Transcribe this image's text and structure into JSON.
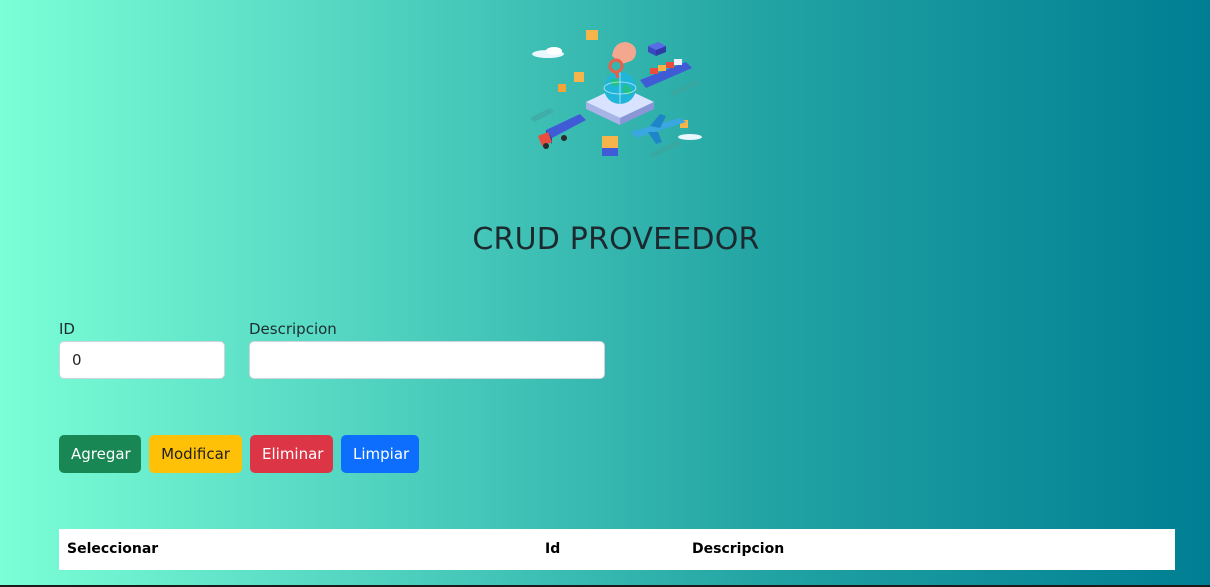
{
  "hero": {
    "icon": "global-logistics-illustration"
  },
  "page": {
    "title": "CRUD PROVEEDOR"
  },
  "form": {
    "id_label": "ID",
    "id_value": "0",
    "descripcion_label": "Descripcion",
    "descripcion_value": ""
  },
  "buttons": {
    "agregar": "Agregar",
    "modificar": "Modificar",
    "eliminar": "Eliminar",
    "limpiar": "Limpiar"
  },
  "table": {
    "columns": [
      "Seleccionar",
      "Id",
      "Descripcion"
    ],
    "rows": []
  },
  "colors": {
    "gradient_start": "#7bffd6",
    "gradient_end": "#007e93",
    "success": "#198754",
    "warning": "#ffc107",
    "danger": "#dc3545",
    "primary": "#0d6efd"
  }
}
